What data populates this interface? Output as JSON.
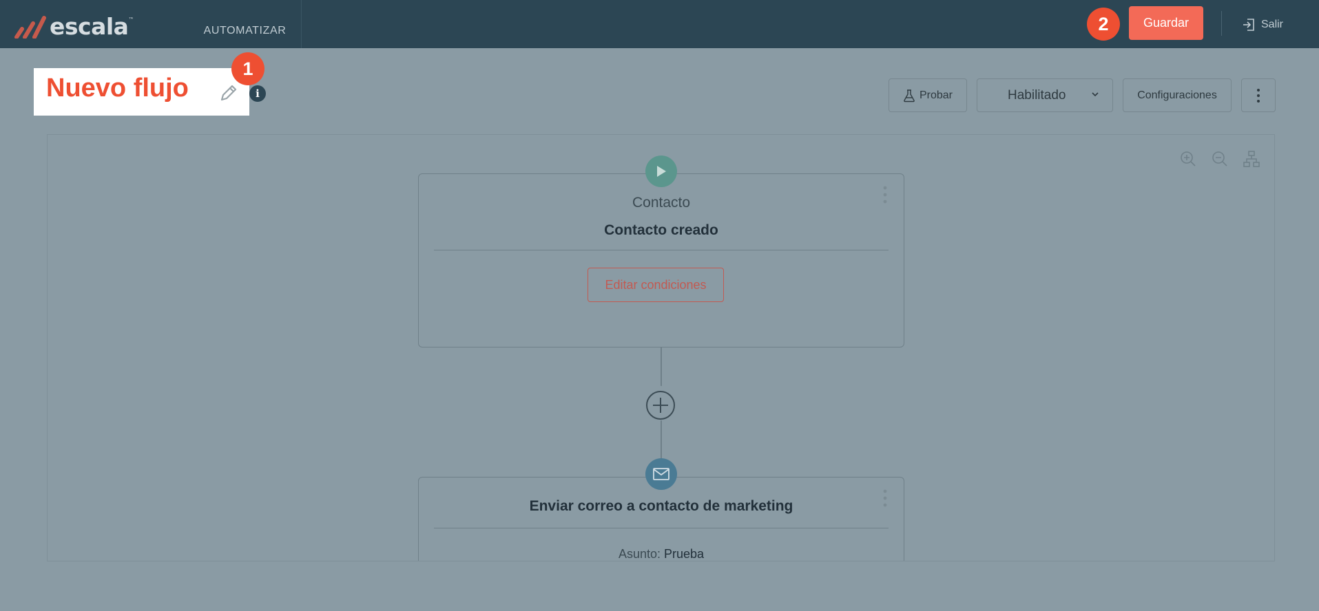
{
  "app": {
    "logo_text": "escala",
    "logo_tm": "™",
    "nav_item": "AUTOMATIZAR"
  },
  "header": {
    "save_label": "Guardar",
    "logout_label": "Salir"
  },
  "annotations": {
    "badge_1": "1",
    "badge_2": "2",
    "badge_color": "#ee4f32"
  },
  "flow": {
    "title": "Nuevo flujo",
    "info_glyph": "i"
  },
  "toolbar": {
    "test_label": "Probar",
    "status_value": "Habilitado",
    "settings_label": "Configuraciones"
  },
  "canvas": {
    "trigger": {
      "category": "Contacto",
      "title": "Contacto creado",
      "edit_conditions_label": "Editar condiciones",
      "icon": "play-icon"
    },
    "action": {
      "title": "Enviar correo a contacto de marketing",
      "subject_label": "Asunto:",
      "subject_value": "Prueba",
      "icon": "mail-icon"
    }
  },
  "colors": {
    "topbar": "#2c4654",
    "accent": "#f36a57",
    "overlay_bg": "#8a9ba4"
  }
}
